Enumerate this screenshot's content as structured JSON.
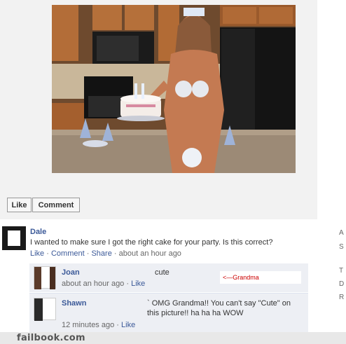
{
  "post": {
    "like_button": "Like",
    "comment_button": "Comment"
  },
  "comments": [
    {
      "author": "Dale",
      "text": "I wanted to make sure I got the right cake for your party. Is this correct?",
      "actions": {
        "like": "Like",
        "comment": "Comment",
        "share": "Share"
      },
      "timestamp": "about an hour ago"
    }
  ],
  "replies": [
    {
      "author": "Joan",
      "text": "cute",
      "timestamp": "about an hour ago",
      "like": "Like",
      "annotation": "<—Grandma"
    },
    {
      "author": "Shawn",
      "text": "` OMG Grandma!! You can't say \"Cute\" on this picture!! ha ha ha WOW",
      "timestamp": "12 minutes ago",
      "like": "Like"
    }
  ],
  "right_column": [
    "A",
    "S",
    "T",
    "D",
    "R"
  ],
  "footer": {
    "brand": "failbook.com"
  }
}
